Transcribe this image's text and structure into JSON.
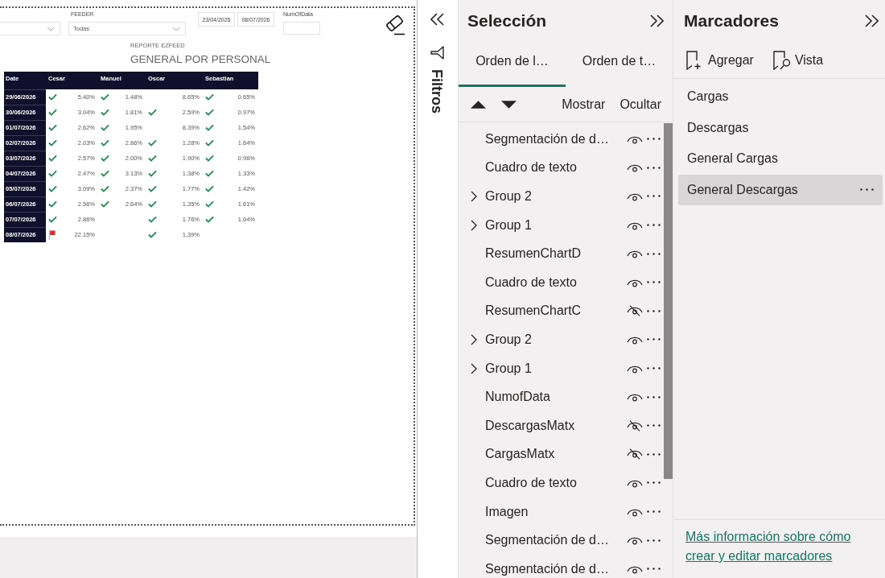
{
  "report": {
    "slicers": [
      {
        "kind": "dropdown"
      },
      {
        "kind": "dropdown",
        "label": "FEEDER",
        "value": "Todas"
      },
      {
        "kind": "date_range",
        "values": [
          "23/04/2026",
          "08/07/2026"
        ]
      },
      {
        "kind": "card",
        "label": "NumOfData"
      }
    ],
    "subtitle": "REPORTE EZFEED",
    "title": "GENERAL POR PERSONAL",
    "table": {
      "columns": [
        "Date",
        "Cesar",
        "Manuel",
        "Oscar",
        "Sebastian"
      ],
      "rows": [
        {
          "date": "29/06/2026",
          "cells": [
            {
              "kind": "check",
              "value": "5.40%"
            },
            {
              "kind": "check",
              "value": "1.48%"
            },
            {
              "kind": "plain",
              "value": "8.65%"
            },
            {
              "kind": "check",
              "value": "0.65%"
            }
          ]
        },
        {
          "date": "30/06/2026",
          "cells": [
            {
              "kind": "check",
              "value": "3.04%"
            },
            {
              "kind": "check",
              "value": "1.81%"
            },
            {
              "kind": "check",
              "value": "2.59%"
            },
            {
              "kind": "check",
              "value": "0.97%"
            }
          ]
        },
        {
          "date": "01/07/2026",
          "cells": [
            {
              "kind": "check",
              "value": "2.62%"
            },
            {
              "kind": "check",
              "value": "1.95%"
            },
            {
              "kind": "plain",
              "value": "8.39%"
            },
            {
              "kind": "check",
              "value": "1.54%"
            }
          ]
        },
        {
          "date": "02/07/2026",
          "cells": [
            {
              "kind": "check",
              "value": "2.03%"
            },
            {
              "kind": "check",
              "value": "2.86%"
            },
            {
              "kind": "check",
              "value": "1.28%"
            },
            {
              "kind": "check",
              "value": "1.64%"
            }
          ]
        },
        {
          "date": "03/07/2026",
          "cells": [
            {
              "kind": "check",
              "value": "2.57%"
            },
            {
              "kind": "check",
              "value": "2.00%"
            },
            {
              "kind": "check",
              "value": "1.90%"
            },
            {
              "kind": "check",
              "value": "0.96%"
            }
          ]
        },
        {
          "date": "04/07/2026",
          "cells": [
            {
              "kind": "check",
              "value": "2.47%"
            },
            {
              "kind": "check",
              "value": "3.13%"
            },
            {
              "kind": "check",
              "value": "1.38%"
            },
            {
              "kind": "check",
              "value": "1.33%"
            }
          ]
        },
        {
          "date": "05/07/2026",
          "cells": [
            {
              "kind": "check",
              "value": "3.09%"
            },
            {
              "kind": "check",
              "value": "2.37%"
            },
            {
              "kind": "check",
              "value": "1.77%"
            },
            {
              "kind": "check",
              "value": "1.42%"
            }
          ]
        },
        {
          "date": "06/07/2026",
          "cells": [
            {
              "kind": "check",
              "value": "2.56%"
            },
            {
              "kind": "check",
              "value": "2.64%"
            },
            {
              "kind": "check",
              "value": "1.35%"
            },
            {
              "kind": "check",
              "value": "1.61%"
            }
          ]
        },
        {
          "date": "07/07/2026",
          "cells": [
            {
              "kind": "check",
              "value": "2.86%"
            },
            null,
            {
              "kind": "check",
              "value": "1.76%"
            },
            {
              "kind": "check",
              "value": "1.04%"
            }
          ]
        },
        {
          "date": "08/07/2026",
          "cells": [
            {
              "kind": "flag",
              "value": "22.15%"
            },
            null,
            {
              "kind": "check",
              "value": "1.39%"
            },
            null
          ]
        }
      ]
    }
  },
  "filters_pane": {
    "label": "Filtros"
  },
  "selection_pane": {
    "title": "Selección",
    "tabs": [
      {
        "label": "Orden de l…",
        "selected": true
      },
      {
        "label": "Orden de t…",
        "selected": false
      }
    ],
    "toolbar": [
      "Mostrar",
      "Ocultar"
    ],
    "layers": [
      {
        "name": "Segmentación de d…",
        "kind": "item",
        "visible": true
      },
      {
        "name": "Cuadro de texto",
        "kind": "item",
        "visible": true
      },
      {
        "name": "Group 2",
        "kind": "group",
        "expanded": false,
        "visible": true
      },
      {
        "name": "Group 1",
        "kind": "group",
        "expanded": false,
        "visible": true
      },
      {
        "name": "ResumenChartD",
        "kind": "item",
        "visible": true
      },
      {
        "name": "Cuadro de texto",
        "kind": "item",
        "visible": true
      },
      {
        "name": "ResumenChartC",
        "kind": "item",
        "visible": false
      },
      {
        "name": "Group 2",
        "kind": "group",
        "expanded": false,
        "visible": true
      },
      {
        "name": "Group 1",
        "kind": "group",
        "expanded": false,
        "visible": true
      },
      {
        "name": "NumofData",
        "kind": "item",
        "visible": true
      },
      {
        "name": "DescargasMatx",
        "kind": "item",
        "visible": false
      },
      {
        "name": "CargasMatx",
        "kind": "item",
        "visible": false
      },
      {
        "name": "Cuadro de texto",
        "kind": "item",
        "visible": true
      },
      {
        "name": "Imagen",
        "kind": "item",
        "visible": true
      },
      {
        "name": "Segmentación de d…",
        "kind": "item",
        "visible": true
      },
      {
        "name": "Segmentación de d…",
        "kind": "item",
        "visible": true
      }
    ]
  },
  "bookmarks_pane": {
    "title": "Marcadores",
    "actions": [
      {
        "kind": "add",
        "label": "Agregar"
      },
      {
        "kind": "view",
        "label": "Vista"
      }
    ],
    "items": [
      {
        "label": "Cargas",
        "selected": false
      },
      {
        "label": "Descargas",
        "selected": false
      },
      {
        "label": "General Cargas",
        "selected": false
      },
      {
        "label": "General Descargas",
        "selected": true
      }
    ],
    "help_link": "Más información sobre cómo crear y editar marcadores"
  }
}
